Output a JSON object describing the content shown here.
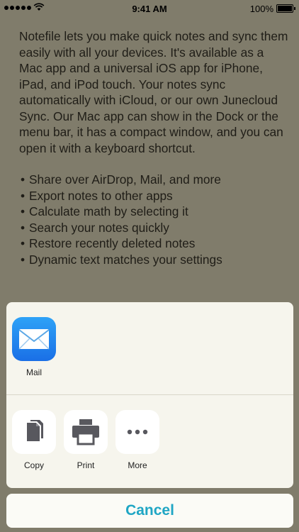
{
  "status_bar": {
    "time": "9:41 AM",
    "battery": "100%"
  },
  "note": {
    "paragraph": "Notefile lets you make quick notes and sync them easily with all your devices. It's available as a Mac app and a universal iOS app for iPhone, iPad, and iPod touch. Your notes sync automatically with iCloud, or our own Junecloud Sync. Our Mac app can show in the Dock or the menu bar, it has a compact window, and you can open it with a keyboard shortcut.",
    "bullets": [
      "Share over AirDrop, Mail, and more",
      "Export notes to other apps",
      "Calculate math by selecting it",
      "Search your notes quickly",
      "Restore recently deleted notes",
      "Dynamic text matches your settings"
    ]
  },
  "share_sheet": {
    "apps": [
      {
        "label": "Mail",
        "icon": "mail-icon"
      }
    ],
    "actions": [
      {
        "label": "Copy",
        "icon": "copy-icon"
      },
      {
        "label": "Print",
        "icon": "print-icon"
      },
      {
        "label": "More",
        "icon": "more-icon"
      }
    ]
  },
  "cancel_label": "Cancel",
  "colors": {
    "accent": "#1fa6c4",
    "sheet_background": "#f6f5ed",
    "backdrop": "#807c6b"
  }
}
